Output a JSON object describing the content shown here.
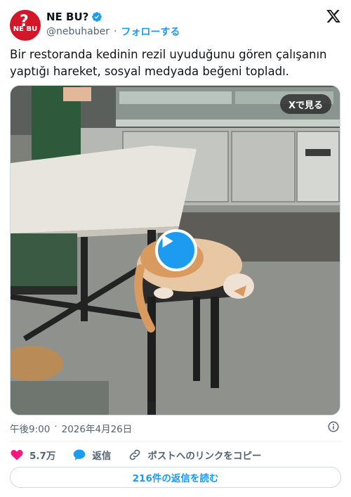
{
  "account": {
    "display_name": "NE BU?",
    "handle": "@nebuhaber",
    "separator": "·",
    "follow_label": "フォローする",
    "avatar_text": "NE BU",
    "avatar_symbol": "?",
    "verified_color": "#1d9bf0"
  },
  "tweet": {
    "text": "Bir restoranda kedinin rezil uyuduğunu gören çalışanın yaptığı hareket, sosyal medyada beğeni topladı."
  },
  "media": {
    "view_on_x_label": "Xで見る",
    "kind": "video"
  },
  "meta": {
    "time": "午後9:00",
    "separator": "·",
    "date": "2026年4月26日"
  },
  "actions": {
    "like_count": "5.7万",
    "reply_label": "返信",
    "copy_link_label": "ポストへのリンクをコピー"
  },
  "read_replies_label": "216件の返信を読む",
  "colors": {
    "accent": "#1d9bf0",
    "like": "#f91880",
    "brand_red": "#d3172b"
  }
}
